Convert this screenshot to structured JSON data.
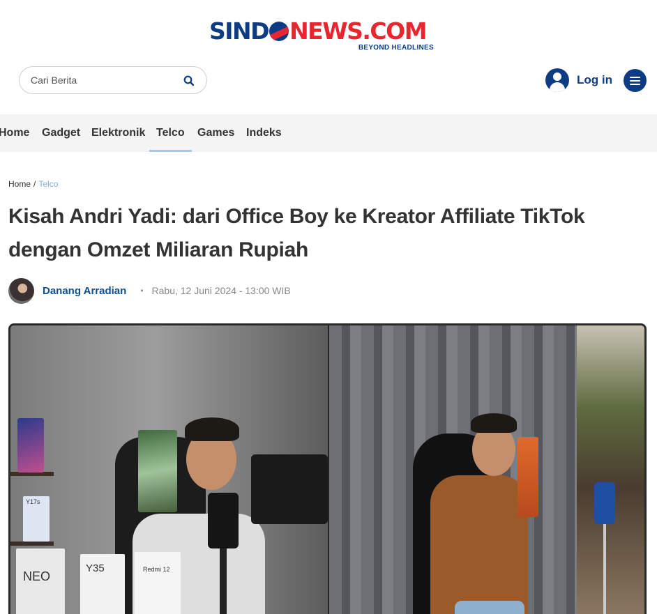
{
  "header": {
    "logo": {
      "part1": "SIND",
      "part2": "NEWS.COM",
      "tagline": "BEYOND HEADLINES"
    },
    "search": {
      "placeholder": "Cari Berita",
      "icon": "search-icon"
    },
    "login": {
      "label": "Log in",
      "icon": "user-icon"
    },
    "menu": {
      "icon": "hamburger-menu-icon"
    }
  },
  "nav": {
    "items": [
      {
        "label": "Home"
      },
      {
        "label": "Gadget"
      },
      {
        "label": "Elektronik"
      },
      {
        "label": "Telco",
        "active": true
      },
      {
        "label": "Games"
      },
      {
        "label": "Indeks"
      }
    ]
  },
  "breadcrumb": {
    "home": "Home",
    "separator": "/",
    "current": "Telco"
  },
  "article": {
    "title": "Kisah Andri Yadi: dari Office Boy ke Kreator Affiliate TikTok dengan Omzet Miliaran Rupiah",
    "author": "Danang Arradian",
    "separator": "•",
    "date": "Rabu, 12 Juni 2024 - 13:00 WIB"
  },
  "photo": {
    "box_labels": [
      "NEO",
      "Y35",
      "Redmi 12",
      "Y17s"
    ]
  },
  "colors": {
    "brand_blue": "#0d3b84",
    "brand_red": "#e8262f",
    "nav_bg": "#f4f4f4",
    "active_underline": "#a9c7e3",
    "breadcrumb_current": "#7fb0dc",
    "author": "#0d4f8f"
  }
}
